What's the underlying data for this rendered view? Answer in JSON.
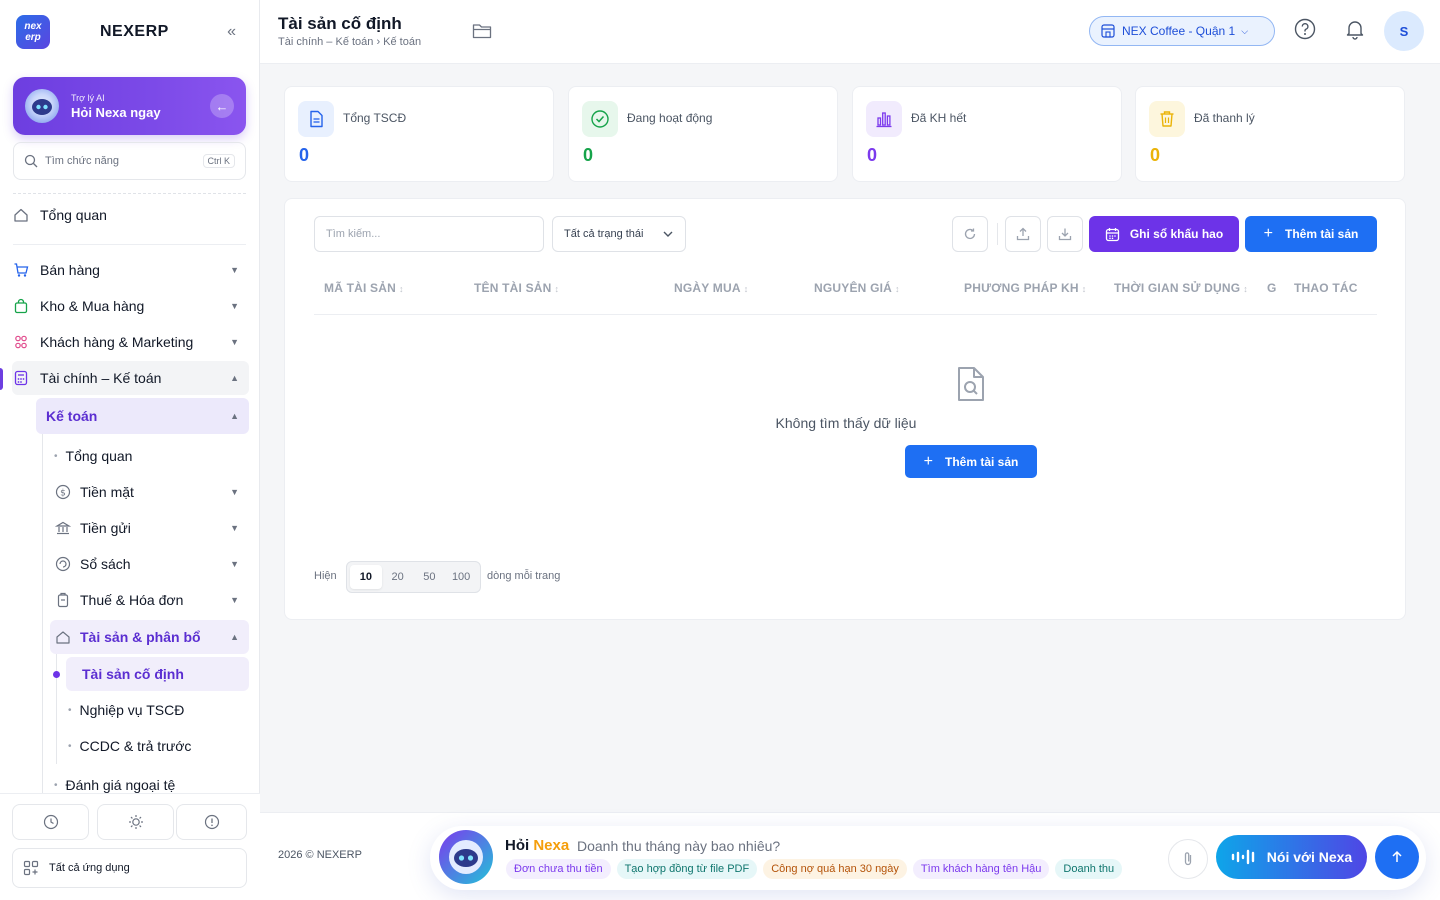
{
  "sidebar": {
    "logo_top": "nex",
    "logo_bottom": "erp",
    "brand": "NEXERP",
    "ai_card": {
      "subtitle": "Trợ lý AI",
      "title": "Hỏi Nexa ngay"
    },
    "search": {
      "placeholder": "Tìm chức năng",
      "shortcut": "Ctrl K"
    },
    "items": [
      {
        "label": "Tổng quan",
        "icon": "home-icon"
      },
      {
        "label": "Bán hàng",
        "icon": "cart-icon"
      },
      {
        "label": "Kho & Mua hàng",
        "icon": "bag-icon"
      },
      {
        "label": "Khách hàng & Marketing",
        "icon": "users-icon"
      },
      {
        "label": "Tài chính – Kế toán",
        "icon": "calculator-icon"
      }
    ],
    "accounting": {
      "label": "Kế toán",
      "children": [
        {
          "label": "Tổng quan"
        },
        {
          "label": "Tiền mặt",
          "icon": "dollar-icon"
        },
        {
          "label": "Tiền gửi",
          "icon": "bank-icon"
        },
        {
          "label": "Sổ sách",
          "icon": "book-icon"
        },
        {
          "label": "Thuế & Hóa đơn",
          "icon": "tax-icon"
        },
        {
          "label": "Tài sản & phân bổ",
          "icon": "asset-icon"
        }
      ],
      "assets_children": [
        "Tài sản cố định",
        "Nghiệp vụ TSCĐ",
        "CCDC & trả trước"
      ],
      "more": "Đánh giá ngoại tệ"
    },
    "all_apps": "Tất cả ứng dụng"
  },
  "header": {
    "title": "Tài sản cố định",
    "breadcrumb": "Tài chính – Kế toán › Kế toán",
    "branch": "NEX Coffee - Quận 1",
    "avatar": "S"
  },
  "stats": [
    {
      "label": "Tổng TSCĐ",
      "value": "0",
      "color": "#2563eb",
      "bg": "#e8f0fe"
    },
    {
      "label": "Đang hoạt động",
      "value": "0",
      "color": "#16a34a",
      "bg": "#e7f7ec"
    },
    {
      "label": "Đã KH hết",
      "value": "0",
      "color": "#7c3aed",
      "bg": "#f1ebfd"
    },
    {
      "label": "Đã thanh lý",
      "value": "0",
      "color": "#eab308",
      "bg": "#fdf6dd"
    }
  ],
  "toolbar": {
    "search_placeholder": "Tìm kiếm...",
    "status_filter": "Tất cả trạng thái",
    "depreciation_button": "Ghi sổ khấu hao",
    "add_button": "Thêm tài sản"
  },
  "table": {
    "columns": [
      "MÃ TÀI SẢN",
      "TÊN TÀI SẢN",
      "NGÀY MUA",
      "NGUYÊN GIÁ",
      "PHƯƠNG PHÁP KH",
      "THỜI GIAN SỬ DỤNG",
      "G",
      "THAO TÁC"
    ],
    "empty_text": "Không tìm thấy dữ liệu",
    "empty_button": "Thêm tài sản"
  },
  "pagination": {
    "show_label": "Hiện",
    "sizes": [
      "10",
      "20",
      "50",
      "100"
    ],
    "selected": "10",
    "per_page_label": "dòng mỗi trang"
  },
  "footer": {
    "copyright": "2026 © NEXERP",
    "chat": {
      "title_a": "Hỏi",
      "title_b": "Nexa",
      "question": "Doanh thu tháng này bao nhiêu?",
      "chips": [
        "Đơn chưa thu tiền",
        "Tạo hợp đồng từ file PDF",
        "Công nợ quá hạn 30 ngày",
        "Tìm khách hàng tên Hậu",
        "Doanh thu"
      ],
      "voice_button": "Nói với Nexa"
    }
  },
  "colors": {
    "accent_purple": "#6d33e8",
    "accent_blue": "#1e6ff3"
  }
}
